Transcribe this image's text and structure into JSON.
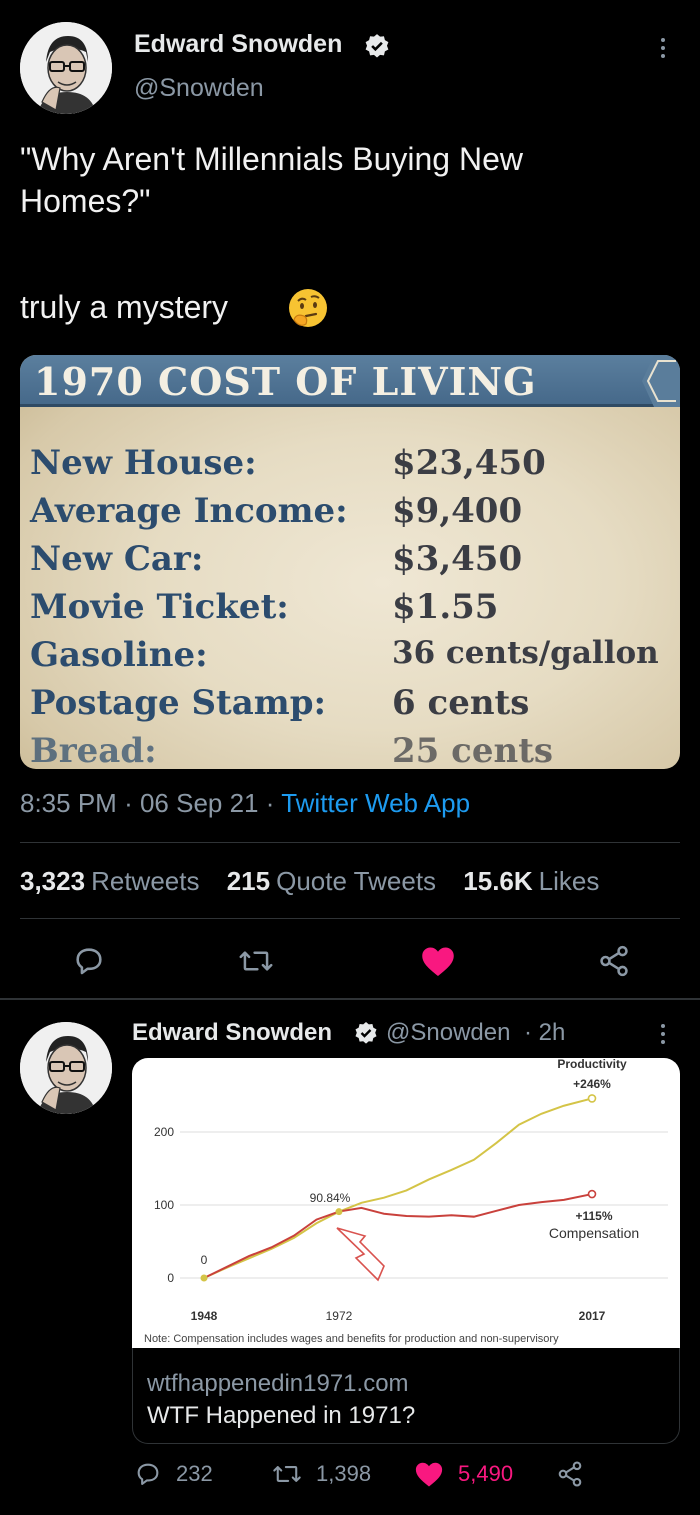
{
  "main_tweet": {
    "author_name": "Edward Snowden",
    "handle": "@Snowden",
    "text_line1": "\"Why Aren't Millennials Buying New",
    "text_line2": "Homes?\"",
    "text_line3": "truly a mystery",
    "emoji": "thinking-face-icon",
    "image": {
      "title": "1970 COST OF LIVING",
      "rows": [
        {
          "label": "New House:",
          "value": "$23,450"
        },
        {
          "label": "Average Income:",
          "value": "$9,400"
        },
        {
          "label": "New Car:",
          "value": "$3,450"
        },
        {
          "label": "Movie Ticket:",
          "value": "$1.55"
        },
        {
          "label": "Gasoline:",
          "value": "36 cents/gallon"
        },
        {
          "label": "Postage Stamp:",
          "value": "6 cents"
        },
        {
          "label": "Bread:",
          "value": "25 cents"
        }
      ]
    },
    "time": "8:35 PM",
    "date": "06 Sep 21",
    "dot": "·",
    "source_app": "Twitter Web App",
    "stats": {
      "retweets_count": "3,323",
      "retweets_label": "Retweets",
      "quotes_count": "215",
      "quotes_label": "Quote Tweets",
      "likes_count": "15.6K",
      "likes_label": "Likes"
    },
    "actions": [
      "reply-icon",
      "retweet-icon",
      "like-icon",
      "share-icon"
    ]
  },
  "second_tweet": {
    "author_name": "Edward Snowden",
    "handle": "@Snowden",
    "time_ago": "· 2h",
    "chart_labels": {
      "productivity_label": "Productivity",
      "productivity_change": "+246%",
      "compensation_change": "+115%",
      "compensation_label": "Compensation",
      "divergence_label": "90.84%",
      "origin_label": "0",
      "note": "Note: Compensation includes wages and benefits for production and non-supervisory"
    },
    "chart_data": {
      "type": "line",
      "x": [
        1948,
        1972,
        2017
      ],
      "xticks": [
        "1948",
        "1972",
        "2017"
      ],
      "yticks": [
        "0",
        "100",
        "200"
      ],
      "ylim": [
        0,
        250
      ],
      "series": [
        {
          "name": "Productivity",
          "x": [
            1948,
            1952,
            1956,
            1960,
            1964,
            1968,
            1972,
            1976,
            1980,
            1984,
            1988,
            1992,
            1996,
            2000,
            2004,
            2008,
            2012,
            2017
          ],
          "values": [
            0,
            14,
            27,
            40,
            55,
            75,
            90.84,
            103,
            110,
            120,
            135,
            148,
            162,
            185,
            210,
            225,
            236,
            246
          ],
          "color": "#d4c447"
        },
        {
          "name": "Compensation",
          "x": [
            1948,
            1952,
            1956,
            1960,
            1964,
            1968,
            1972,
            1976,
            1980,
            1984,
            1988,
            1992,
            1996,
            2000,
            2004,
            2008,
            2012,
            2017
          ],
          "values": [
            0,
            15,
            30,
            42,
            58,
            80,
            91,
            96,
            88,
            85,
            84,
            86,
            84,
            92,
            100,
            104,
            107,
            115
          ],
          "color": "#c9413c"
        }
      ]
    },
    "link": {
      "domain": "wtfhappenedin1971.com",
      "title": "WTF Happened in 1971?"
    },
    "counts": {
      "replies": "232",
      "retweets": "1,398",
      "likes": "5,490"
    }
  }
}
